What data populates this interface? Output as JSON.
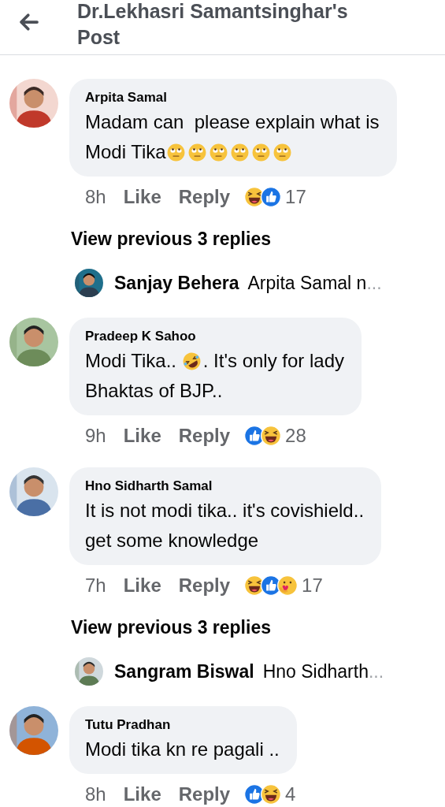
{
  "header": {
    "title": "Dr.Lekhasri Samantsinghar's Post"
  },
  "items": [
    {
      "kind": "comment",
      "name": "Arpita Samal",
      "lines": [
        [
          {
            "kind": "text",
            "text": "Madam can  please explain what is"
          }
        ],
        [
          {
            "kind": "text",
            "text": "Modi Tika"
          },
          {
            "kind": "eyeroll"
          },
          {
            "kind": "eyeroll"
          },
          {
            "kind": "eyeroll"
          },
          {
            "kind": "eyeroll"
          },
          {
            "kind": "eyeroll"
          },
          {
            "kind": "eyeroll"
          }
        ]
      ],
      "time": "8h",
      "like": "Like",
      "reply": "Reply",
      "reactions": [
        {
          "kind": "haha"
        },
        {
          "kind": "like"
        }
      ],
      "count": "17"
    },
    {
      "kind": "more",
      "label": "View previous 3 replies"
    },
    {
      "kind": "reply_preview",
      "name": "Sanjay Behera",
      "text": "Arpita Samal n",
      "ellipsis": "..."
    },
    {
      "kind": "comment",
      "name": "Pradeep K Sahoo",
      "lines": [
        [
          {
            "kind": "text",
            "text": "Modi Tika.. "
          },
          {
            "kind": "rofl"
          },
          {
            "kind": "text",
            "text": ". It's only for lady"
          }
        ],
        [
          {
            "kind": "text",
            "text": "Bhaktas of BJP.."
          }
        ]
      ],
      "time": "9h",
      "like": "Like",
      "reply": "Reply",
      "reactions": [
        {
          "kind": "like"
        },
        {
          "kind": "haha"
        }
      ],
      "count": "28"
    },
    {
      "kind": "comment",
      "name": "Hno Sidharth Samal",
      "lines": [
        [
          {
            "kind": "text",
            "text": "It is not modi tika.. it's covishield.."
          }
        ],
        [
          {
            "kind": "text",
            "text": "get some knowledge"
          }
        ]
      ],
      "time": "7h",
      "like": "Like",
      "reply": "Reply",
      "reactions": [
        {
          "kind": "haha"
        },
        {
          "kind": "like"
        },
        {
          "kind": "care"
        }
      ],
      "count": "17"
    },
    {
      "kind": "more",
      "label": "View previous 3 replies"
    },
    {
      "kind": "reply_preview",
      "name": "Sangram Biswal",
      "text": "Hno Sidharth",
      "ellipsis": "..."
    },
    {
      "kind": "comment",
      "name": "Tutu Pradhan",
      "lines": [
        [
          {
            "kind": "text",
            "text": "Modi tika kn re pagali .."
          }
        ]
      ],
      "time": "8h",
      "like": "Like",
      "reply": "Reply",
      "reactions": [
        {
          "kind": "like"
        },
        {
          "kind": "haha"
        }
      ],
      "count": "4"
    }
  ]
}
